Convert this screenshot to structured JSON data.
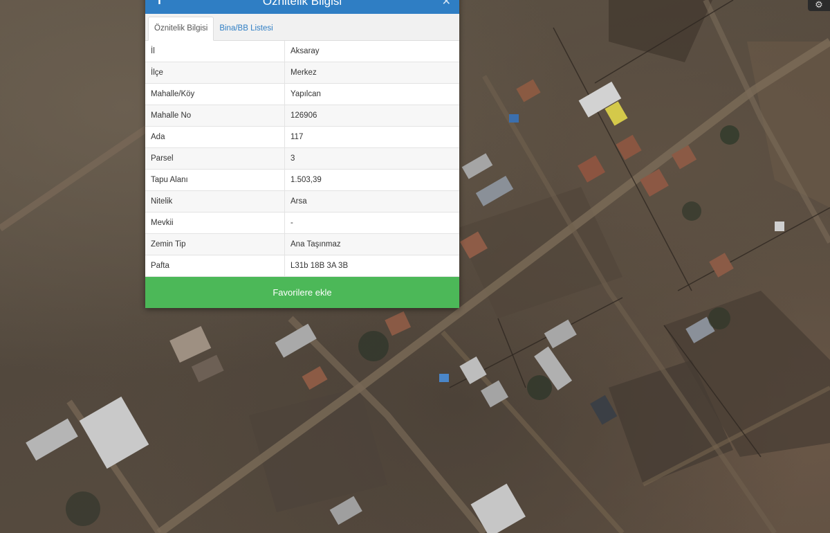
{
  "panel": {
    "title": "Öznitelik Bilgisi",
    "tabs": [
      {
        "label": "Öznitelik Bilgisi",
        "active": true
      },
      {
        "label": "Bina/BB Listesi",
        "active": false
      }
    ],
    "rows": [
      {
        "key": "İl",
        "value": "Aksaray"
      },
      {
        "key": "İlçe",
        "value": "Merkez"
      },
      {
        "key": "Mahalle/Köy",
        "value": "Yapılcan"
      },
      {
        "key": "Mahalle No",
        "value": "126906"
      },
      {
        "key": "Ada",
        "value": "117"
      },
      {
        "key": "Parsel",
        "value": "3"
      },
      {
        "key": "Tapu Alanı",
        "value": "1.503,39"
      },
      {
        "key": "Nitelik",
        "value": "Arsa"
      },
      {
        "key": "Mevkii",
        "value": "-"
      },
      {
        "key": "Zemin Tip",
        "value": "Ana Taşınmaz"
      },
      {
        "key": "Pafta",
        "value": "L31b 18B 3A 3B"
      }
    ],
    "favorite_label": "Favorilere ekle"
  },
  "colors": {
    "header": "#2f7ec4",
    "favorite_button": "#4cb858",
    "tab_link": "#2f7ec4"
  },
  "icons": {
    "header_left": "info-icon",
    "header_right": "close-icon",
    "map_corner": "gear-icon"
  }
}
